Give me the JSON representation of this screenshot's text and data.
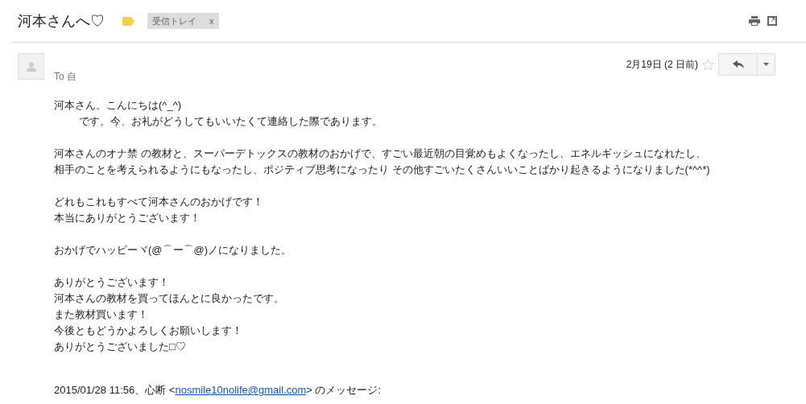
{
  "subject": "河本さんへ♡",
  "important": true,
  "labels": [
    {
      "text": "受信トレイ",
      "remove": "x"
    }
  ],
  "message": {
    "date": "2月19日 (2 日前)",
    "starred": false,
    "to": "To 自",
    "paragraphs": [
      [
        {
          "text": "河本さん。こんにちは(^_^)",
          "indent": false
        },
        {
          "text": "です。今、お礼がどうしてもいいたくて連絡した際であります。",
          "indent": true
        }
      ],
      [
        {
          "text": "河本さんのオナ禁 の教材と、スーパーデトックスの教材のおかげで、すごい最近朝の目覚めもよくなったし、エネルギッシュになれたし、",
          "indent": false
        },
        {
          "text": "相手のことを考えられるようにもなったし、ポジティブ思考になったり その他すごいたくさんいいことばかり起きるようになりました(*^^*)",
          "indent": false
        }
      ],
      [
        {
          "text": "どれもこれもすべて河本さんのおかげです！",
          "indent": false
        },
        {
          "text": "本当にありがとうございます！",
          "indent": false
        }
      ],
      [
        {
          "text": "おかげでハッピーヾ(@⌒ー⌒@)ノになりました。",
          "indent": false
        }
      ],
      [
        {
          "text": "ありがとうございます！",
          "indent": false
        },
        {
          "text": "河本さんの教材を買ってほんとに良かったです。",
          "indent": false
        },
        {
          "text": "また教材買います！",
          "indent": false
        },
        {
          "text": "今後ともどうかよろしくお願いします！",
          "indent": false
        },
        {
          "text": "ありがとうございました□♡",
          "indent": false
        }
      ]
    ],
    "quote": {
      "prefix": "2015/01/28 11:56、心断 <",
      "email": "nosmile10nolife@gmail.com",
      "suffix": "> のメッセージ:"
    }
  }
}
